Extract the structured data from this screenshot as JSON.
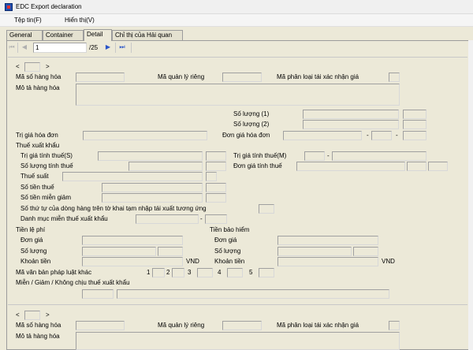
{
  "window": {
    "title": "EDC Export declaration"
  },
  "menu": {
    "file": "Tệp tin(F)",
    "view": "Hiển thị(V)"
  },
  "tabs": [
    "General",
    "Container",
    "Detail",
    "Chỉ thị của Hải quan"
  ],
  "nav": {
    "current_page": "1",
    "total_pages": "/25"
  },
  "item": {
    "prev": "<",
    "next": ">",
    "ma_so_hang_hoa": "Mã số hàng hóa",
    "ma_quan_ly_rieng": "Mã quản lý riêng",
    "ma_phan_loai": "Mã phân loại tái xác nhận giá",
    "mo_ta": "Mô tả hàng hóa",
    "so_luong_1": "Số lượng (1)",
    "so_luong_2": "Số lượng (2)",
    "tri_gia_hoa_don": "Trị giá hóa đơn",
    "don_gia_hoa_don": "Đơn giá hóa đơn",
    "dash": "-"
  },
  "tax": {
    "section": "Thuế xuất khẩu",
    "tri_gia_tinh_thue_s": "Trị giá tính thuế(S)",
    "tri_gia_tinh_thue_m": "Trị giá tính thuế(M)",
    "so_luong_tinh_thue": "Số lượng tính thuế",
    "don_gia_tinh_thue": "Đơn giá tính thuế",
    "thue_suat": "Thuế suất",
    "so_tien_thue": "Số tiền thuế",
    "so_tien_mien_giam": "Số tiền miễn giảm",
    "so_thu_tu": "Số thứ tự của dòng hàng trên tờ khai tạm nhập tái xuất tương ứng",
    "danh_muc": "Danh mục miễn thuế xuất khẩu"
  },
  "fees": {
    "tien_le_phi": "Tiền lệ phí",
    "tien_bao_hiem": "Tiền bảo hiểm",
    "don_gia": "Đơn giá",
    "so_luong": "Số lượng",
    "khoan_tien": "Khoản tiền",
    "vnd": "VND"
  },
  "legal": {
    "ma_van_ban": "Mã văn bản pháp luật khác",
    "n1": "1",
    "n2": "2",
    "n3": "3",
    "n4": "4",
    "n5": "5",
    "mien_giam": "Miễn / Giảm / Không chịu thuế xuất khẩu"
  }
}
